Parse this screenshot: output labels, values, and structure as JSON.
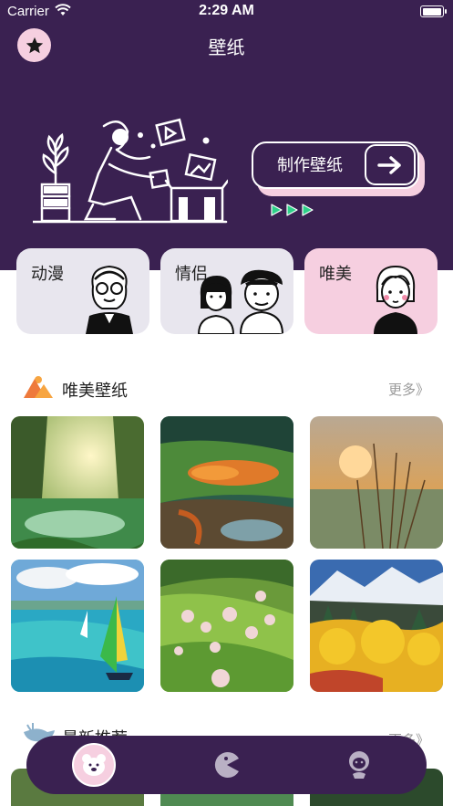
{
  "status_bar": {
    "carrier": "Carrier",
    "time": "2:29 AM",
    "battery_level": 1.0
  },
  "header": {
    "title": "壁纸",
    "favorite_icon": "star-icon"
  },
  "banner": {
    "make_label": "制作壁纸",
    "arrow_icon": "arrow-right-icon"
  },
  "categories": [
    {
      "label": "动漫",
      "icon": "old-man-illustration"
    },
    {
      "label": "情侣",
      "icon": "couple-illustration"
    },
    {
      "label": "唯美",
      "icon": "girl-illustration"
    }
  ],
  "section_beautiful": {
    "icon": "mountain-icon",
    "title": "唯美壁纸",
    "more": "更多》",
    "images": [
      "forest-sunrise",
      "mossy-river",
      "sunset-grass",
      "sailboat-lagoon",
      "blossom-hills",
      "autumn-forest"
    ]
  },
  "section_new": {
    "icon": "whale-icon",
    "title": "最新推荐",
    "more": "更多》"
  },
  "tabbar": {
    "tabs": [
      "bear-icon",
      "pacman-icon",
      "bear-face-icon"
    ],
    "active": 0
  },
  "colors": {
    "primary": "#3a2151",
    "accent": "#f6cfe0",
    "category_bg": "#e8e6ee",
    "play_green": "#2ed089"
  }
}
